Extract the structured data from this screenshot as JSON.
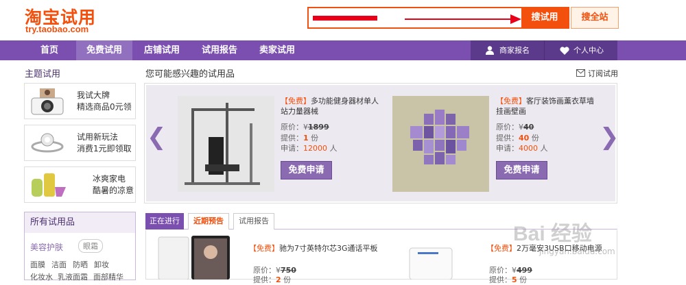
{
  "header": {
    "logo": "淘宝试用",
    "logo_sub": "try.taobao.com",
    "search_placeholder": "",
    "search_button": "搜试用",
    "search_all_button": "搜全站"
  },
  "nav": {
    "items": [
      "首页",
      "免费试用",
      "店铺试用",
      "试用报告",
      "卖家试用"
    ],
    "merchant_signup": "商家报名",
    "personal_center": "个人中心"
  },
  "sidebar": {
    "theme_title": "主题试用",
    "themes": [
      {
        "line1": "我试大牌",
        "line2": "精选商品0元领"
      },
      {
        "line1": "试用新玩法",
        "line2": "消费1元即领取"
      },
      {
        "line1": "冰爽家电",
        "line2": "酷暑的凉意"
      }
    ],
    "all_title": "所有试用品",
    "category_main": "美容护肤",
    "category_tag": "眼霜",
    "categories_row1": [
      "面膜",
      "洁面",
      "防晒",
      "卸妆"
    ],
    "categories_row2": [
      "化妆水",
      "乳液面霜",
      "面部精华"
    ]
  },
  "main": {
    "section_title": "您可能感兴趣的试用品",
    "subscribe": "订阅试用",
    "products": [
      {
        "tag": "【免费】",
        "title": "多功能健身器材单人站力量器械",
        "price_label": "原价：",
        "currency": "¥",
        "price": "1899",
        "supply_label": "提供：",
        "supply": "1",
        "supply_unit": "份",
        "apply_label": "申请：",
        "applicants": "12000",
        "applicants_unit": "人",
        "button": "免费申请"
      },
      {
        "tag": "【免费】",
        "title": "客厅装饰画薰衣草墙挂画壁画",
        "price_label": "原价：",
        "currency": "¥",
        "price": "40",
        "supply_label": "提供：",
        "supply": "40",
        "supply_unit": "份",
        "apply_label": "申请：",
        "applicants": "4000",
        "applicants_unit": "人",
        "button": "免费申请"
      }
    ],
    "tabs": [
      "正在进行",
      "近期预告",
      "试用报告"
    ],
    "lower_products": [
      {
        "tag": "【免费】",
        "title": "驰为7寸英特尔芯3G通话平板",
        "price_label": "原价：",
        "price": "750",
        "supply_label": "提供：",
        "supply": "2",
        "supply_unit": "份"
      },
      {
        "tag": "【免费】",
        "title": "2万毫安3USB口移动电源",
        "price_label": "原价：",
        "price": "499",
        "supply_label": "提供：",
        "supply": "5",
        "supply_unit": "份"
      }
    ]
  },
  "watermark": {
    "text": "Bai 经验",
    "url": "jingyan.baidu.com"
  },
  "colors": {
    "brand": "#f2500c",
    "nav": "#7a4fb0",
    "button": "#8a6ab0"
  }
}
